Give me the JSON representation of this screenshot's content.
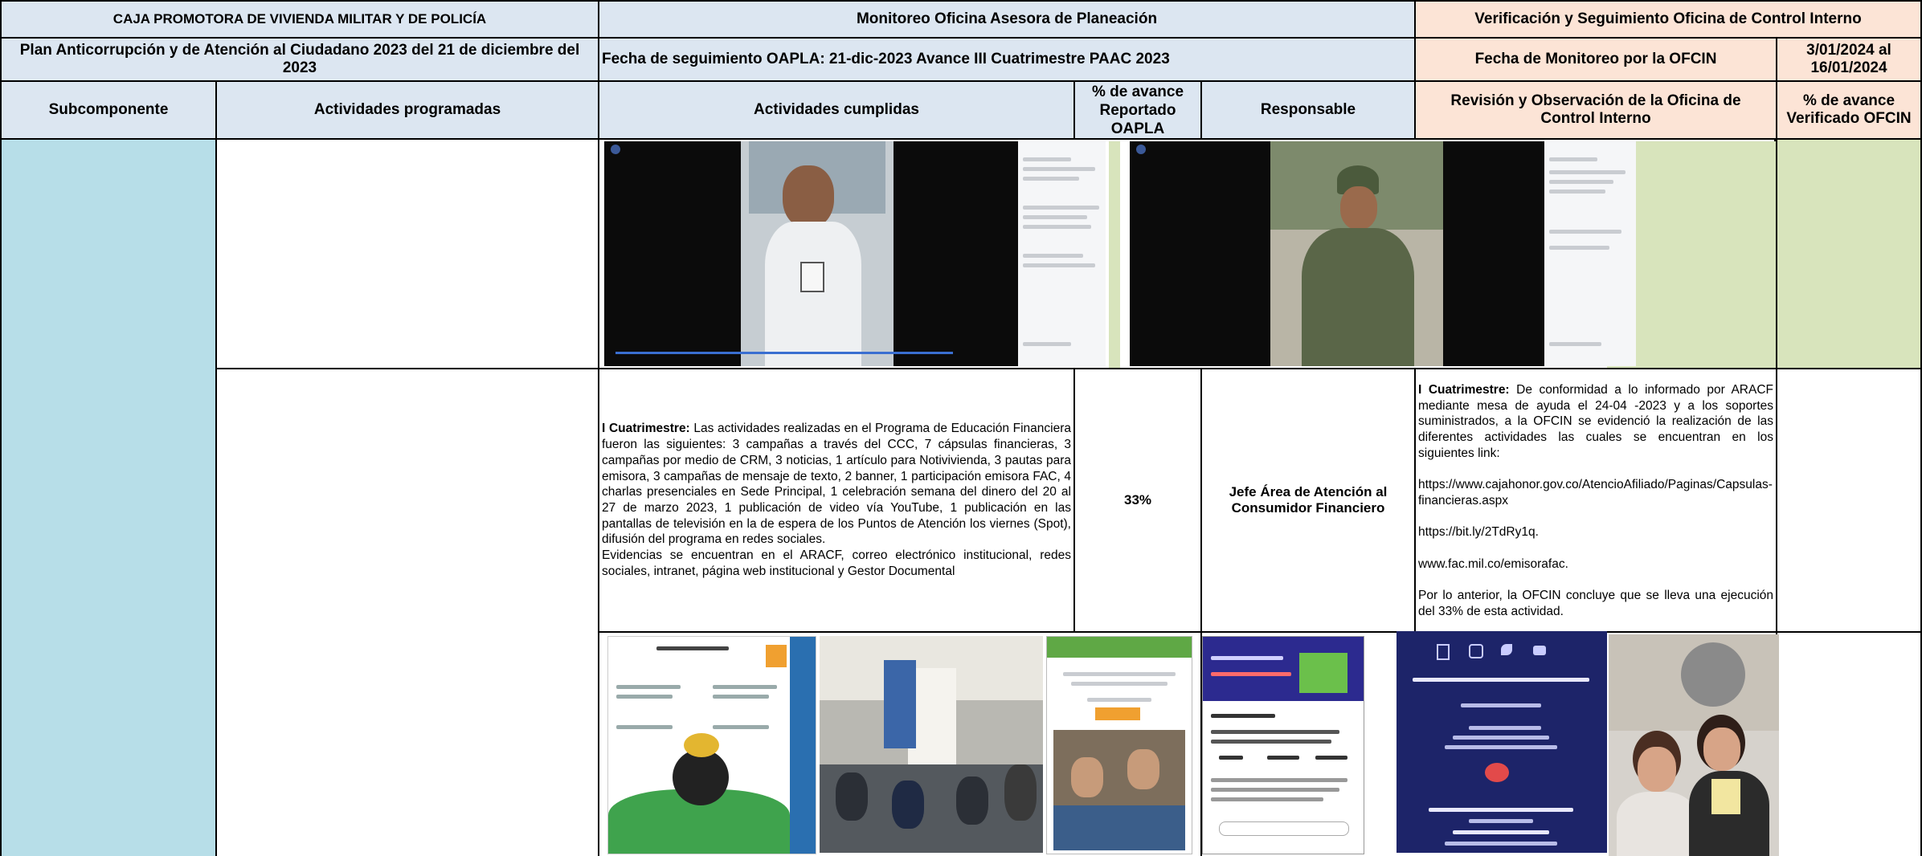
{
  "header": {
    "org_name": "CAJA PROMOTORA DE VIVIENDA MILITAR Y DE POLICÍA",
    "plan_title": "Plan Anticorrupción y de Atención al Ciudadano  2023  del 21 de diciembre del 2023",
    "oapla_title": "Monitoreo Oficina Asesora de Planeación",
    "oapla_followup": "Fecha de seguimiento OAPLA:   21-dic-2023 Avance III Cuatrimestre PAAC 2023",
    "ofcin_title": "Verificación y Seguimiento Oficina de Control Interno",
    "ofcin_monitor_label": "Fecha de Monitoreo por la OFCIN",
    "ofcin_monitor_dates": "3/01/2024 al 16/01/2024"
  },
  "columns": {
    "subcomponente": "Subcomponente",
    "programadas": "Actividades programadas",
    "cumplidas": "Actividades cumplidas",
    "avance_oapla": "% de avance Reportado OAPLA",
    "responsable": "Responsable",
    "revision": "Revisión y Observación de la Oficina de Control Interno",
    "avance_ofcin": "% de avance Verificado OFCIN"
  },
  "row": {
    "cumplidas_label": "I Cuatrimestre:",
    "cumplidas_text": " Las actividades realizadas en el Programa de Educación Financiera fueron las siguientes: 3 campañas a través del CCC, 7 cápsulas financieras, 3 campañas por medio de CRM, 3 noticias, 1 artículo para Notivivienda, 3 pautas para emisora, 3 campañas de mensaje de texto, 2 banner, 1 participación emisora FAC, 4 charlas presenciales en Sede Principal, 1 celebración semana del dinero del 20 al 27 de marzo 2023, 1 publicación de video vía YouTube, 1 publicación en las pantallas de televisión en la de espera de los Puntos de Atención los viernes (Spot), difusión del programa en redes sociales.",
    "cumplidas_evidence": "Evidencias se encuentran en el ARACF, correo electrónico institucional, redes sociales, intranet, página web institucional y Gestor Documental",
    "avance_oapla": "33%",
    "responsable": "Jefe Área de Atención al Consumidor Financiero",
    "revision_label": "I Cuatrimestre:",
    "revision_text": " De conformidad a lo informado por ARACF mediante  mesa de ayuda el 24-04 -2023  y a los soportes suministrados, a la OFCIN se evidenció la realización de las diferentes actividades  las cuales se encuentran en los siguientes link:",
    "link_1": "https://www.cajahonor.gov.co/AtencioAfiliado/Paginas/Capsulas-financieras.aspx",
    "link_2": "https://bit.ly/2TdRy1q.",
    "link_3": "www.fac.mil.co/emisorafac.",
    "revision_conclusion": "Por lo anterior, la OFCIN concluye que se lleva una ejecución del 33% de esta actividad."
  },
  "images": [
    {
      "icon": "video-screenshot-icon",
      "caption": "Video screenshot: man with ID badge speaking"
    },
    {
      "icon": "video-screenshot-icon",
      "caption": "Video screenshot: soldier with microphone"
    },
    {
      "icon": "infographic-icon",
      "caption": "Cápsulas financieras infographic"
    },
    {
      "icon": "photo-icon",
      "caption": "Audience at a talk"
    },
    {
      "icon": "mobile-screenshot-icon",
      "caption": "Aprendiendo con Honor mobile"
    },
    {
      "icon": "mobile-screenshot-icon",
      "caption": "Portal Transaccional mobile"
    },
    {
      "icon": "flyer-icon",
      "caption": "Contact center flyer"
    },
    {
      "icon": "photo-icon",
      "caption": "Radio station photo"
    }
  ],
  "colors": {
    "header_blue": "#dce6f1",
    "header_peach": "#fce4d6",
    "subcomponent_cyan": "#b7dee8",
    "verification_green": "#d8e4bc"
  }
}
